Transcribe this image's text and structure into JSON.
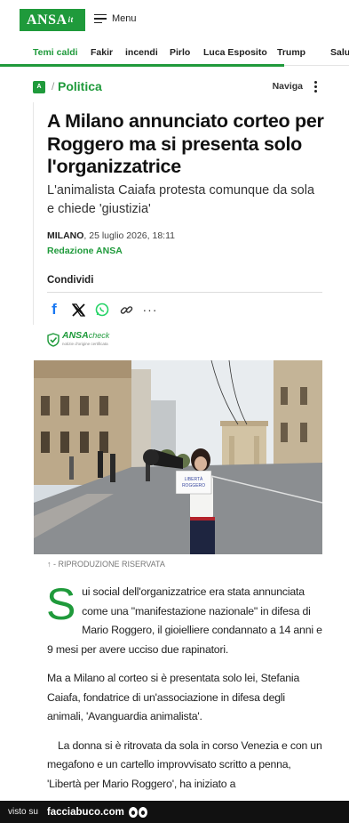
{
  "header": {
    "logo_text": "ANSA",
    "logo_suffix": "it",
    "menu_label": "Menu"
  },
  "topics": [
    "Temi caldi",
    "Fakir",
    "incendi",
    "Pirlo",
    "Luca Esposito",
    "Trump",
    "Salu"
  ],
  "section": {
    "logo_text": "A",
    "separator": "/",
    "name": "Politica",
    "nav_label": "Naviga"
  },
  "article": {
    "headline": "A Milano annunciato corteo per Roggero ma si presenta solo l'organizzatrice",
    "subtitle": "L'animalista Caiafa protesta comunque da sola e chiede 'giustizia'",
    "location": "MILANO",
    "date": ", 25 luglio 2026, 18:11",
    "author": "Redazione ANSA",
    "share_title": "Condividi",
    "check_brand": "ANSA",
    "check_label": "check",
    "check_sub": "notizie d'origine certificata",
    "photo_sign_text": "LIBERTÀ\nROGGERO",
    "caption": "↑ - RIPRODUZIONE RISERVATA",
    "dropcap": "S",
    "p1": "ui social dell'organizzatrice era stata annunciata come una \"manifestazione nazionale\" in difesa di Mario Roggero, il gioielliere condannato a 14 anni e 9 mesi per avere ucciso due rapinatori.",
    "p2": "Ma a Milano al corteo si è presentata solo lei, Stefania Caiafa, fondatrice di un'associazione in difesa degli animali, 'Avanguardia animalista'.",
    "p3": "La donna si è ritrovata da sola in corso Venezia e con un megafono e un cartello improvvisato scritto a penna, 'Libertà per Mario Roggero', ha iniziato a"
  },
  "footer": {
    "visto_su": "visto su",
    "site": "facciabuco.com"
  },
  "icons": [
    "menu-icon",
    "kebab-menu-icon",
    "facebook-icon",
    "x-icon",
    "whatsapp-icon",
    "link-icon",
    "more-icon",
    "shield-check-icon",
    "eyes-icon"
  ],
  "colors": {
    "brand_green": "#1f9a3b",
    "facebook_blue": "#1877f2",
    "whatsapp_green": "#25d366",
    "footer_bg": "#111111"
  }
}
